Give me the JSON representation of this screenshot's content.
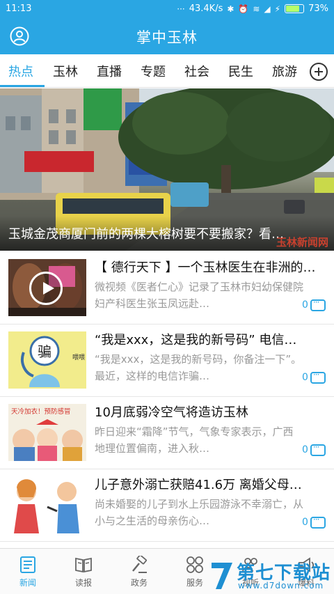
{
  "status_bar": {
    "time": "11:13",
    "network_speed": "43.4K/s",
    "battery": "73%",
    "battery_level": 0.73
  },
  "header": {
    "title": "掌中玉林"
  },
  "tabs": [
    {
      "label": "热点",
      "active": true
    },
    {
      "label": "玉林",
      "active": false
    },
    {
      "label": "直播",
      "active": false
    },
    {
      "label": "专题",
      "active": false
    },
    {
      "label": "社会",
      "active": false
    },
    {
      "label": "民生",
      "active": false
    },
    {
      "label": "旅游",
      "active": false
    }
  ],
  "hero": {
    "caption": "玉城金茂商厦门前的两棵大榕树要不要搬家？看…",
    "watermark": "玉林新闻网"
  },
  "news": [
    {
      "title": "【 德行天下 】一个玉林医生在非洲的…",
      "desc": "微视频《医者仁心》记录了玉林市妇幼保健院妇产科医生张玉凤远赴…",
      "comments": "0",
      "video": true
    },
    {
      "title": "“我是xxx，这是我的新号码” 电信…",
      "desc": "“我是xxx，这是我的新号码，你备注一下”。最近，这样的电信诈骗…",
      "comments": "0",
      "thumb_text": "骗",
      "thumb_sub": "喂喂"
    },
    {
      "title": "10月底弱冷空气将造访玉林",
      "desc": "昨日迎来“霜降”节气，气象专家表示，广西地理位置偏南，进入秋…",
      "comments": "0",
      "thumb_text": "天冷加衣！预防感冒"
    },
    {
      "title": "儿子意外溺亡获赔41.6万 离婚父母…",
      "desc": "尚未婚娶的儿子到水上乐园游泳不幸溺亡，从小与之生活的母亲伤心…",
      "comments": "0"
    }
  ],
  "bottom_nav": [
    {
      "label": "新闻",
      "icon": "news-icon",
      "active": true
    },
    {
      "label": "读报",
      "icon": "newspaper-icon",
      "active": false
    },
    {
      "label": "政务",
      "icon": "gavel-icon",
      "active": false
    },
    {
      "label": "服务",
      "icon": "grid-icon",
      "active": false
    },
    {
      "label": "视听",
      "icon": "people-icon",
      "active": false
    },
    {
      "label": "爆料",
      "icon": "megaphone-icon",
      "active": false
    }
  ],
  "site_logo": {
    "text": "第七下载站",
    "url": "www.d7down.com"
  },
  "colors": {
    "accent": "#2aa6e3"
  }
}
